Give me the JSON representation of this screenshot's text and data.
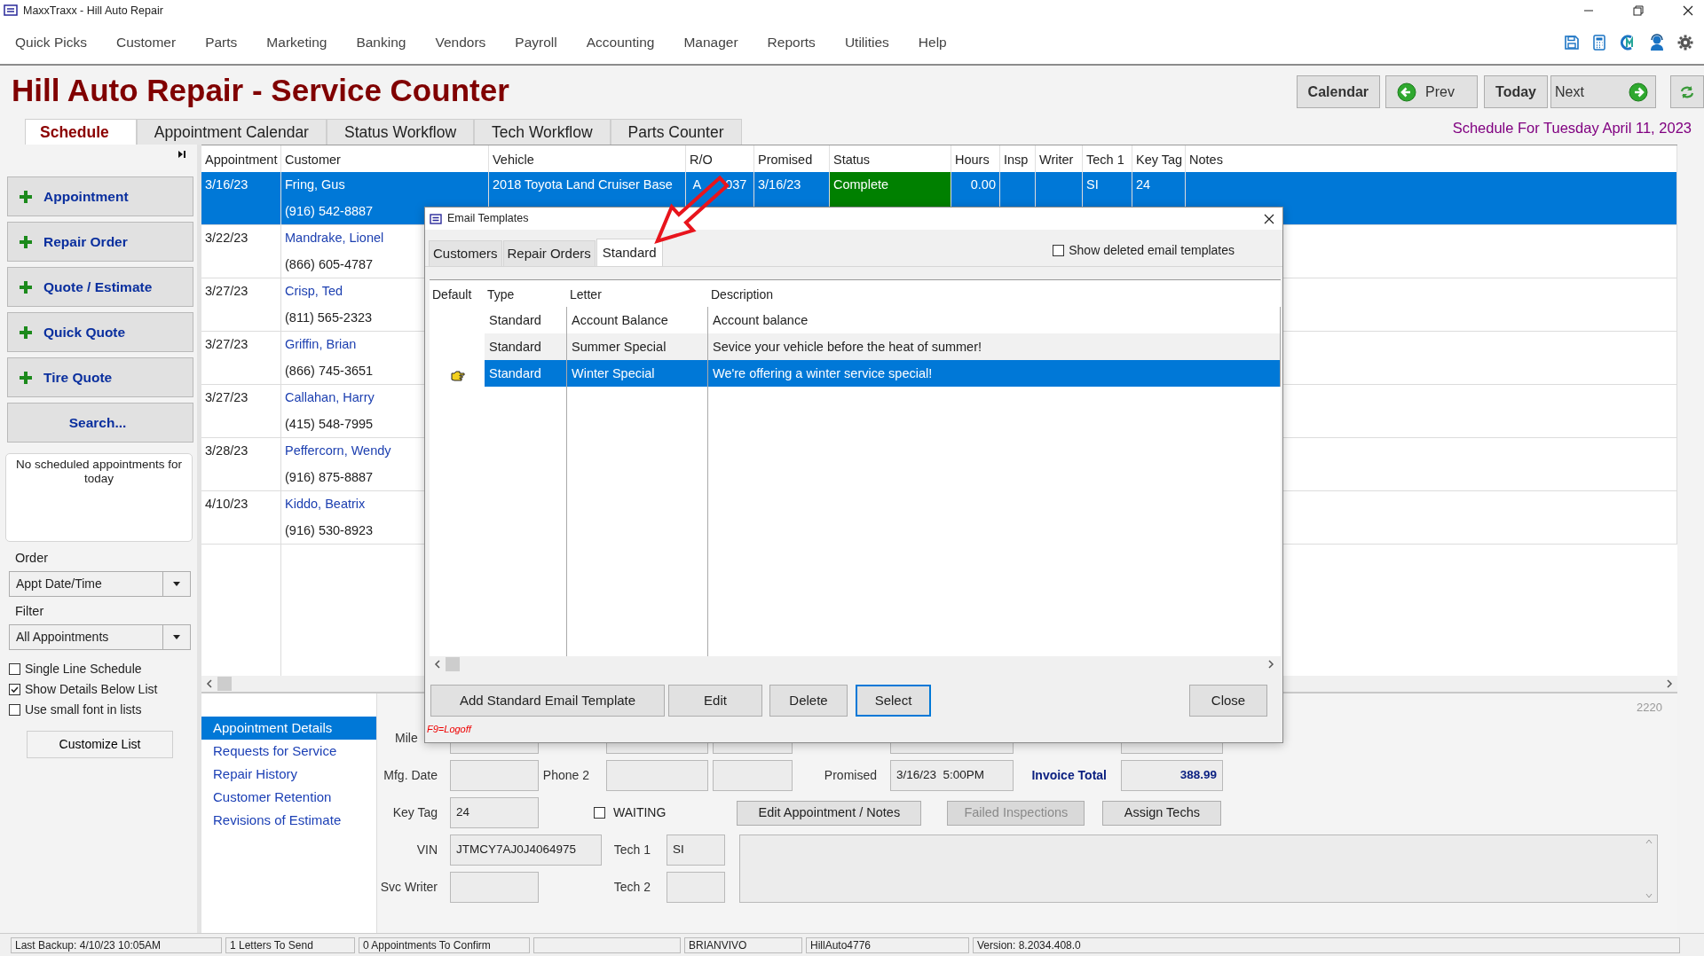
{
  "window": {
    "title": "MaxxTraxx - Hill Auto Repair"
  },
  "menu": [
    {
      "label": "Quick Picks"
    },
    {
      "label": "Customer"
    },
    {
      "label": "Parts"
    },
    {
      "label": "Marketing"
    },
    {
      "label": "Banking"
    },
    {
      "label": "Vendors"
    },
    {
      "label": "Payroll"
    },
    {
      "label": "Accounting"
    },
    {
      "label": "Manager"
    },
    {
      "label": "Reports"
    },
    {
      "label": "Utilities"
    },
    {
      "label": "Help"
    }
  ],
  "header": {
    "title": "Hill Auto Repair - Service Counter",
    "buttons": [
      {
        "kind": "bold",
        "label": "Calendar"
      },
      {
        "kind": "prev",
        "label": "Prev"
      },
      {
        "kind": "bold",
        "label": "Today"
      },
      {
        "kind": "next",
        "label": "Next"
      },
      {
        "kind": "refresh"
      }
    ]
  },
  "tabs": [
    {
      "label": "Schedule",
      "selected": true
    },
    {
      "label": "Appointment Calendar",
      "selected": false
    },
    {
      "label": "Status Workflow",
      "selected": false
    },
    {
      "label": "Tech Workflow",
      "selected": false
    },
    {
      "label": "Parts Counter",
      "selected": false
    }
  ],
  "schedule_caption": "Schedule For Tuesday April 11, 2023",
  "sidebar": {
    "actions": [
      {
        "kind": "add",
        "label": "Appointment"
      },
      {
        "kind": "add",
        "label": "Repair Order"
      },
      {
        "kind": "add",
        "label": "Quote / Estimate"
      },
      {
        "kind": "add",
        "label": "Quick Quote"
      },
      {
        "kind": "add",
        "label": "Tire Quote"
      },
      {
        "kind": "plain",
        "label": "Search..."
      }
    ],
    "notice": "No scheduled appointments for today",
    "order": {
      "label": "Order",
      "value": "Appt Date/Time"
    },
    "filter": {
      "label": "Filter",
      "value": "All Appointments"
    },
    "options": [
      {
        "label": "Single Line Schedule",
        "checked": false
      },
      {
        "label": "Show Details Below List",
        "checked": true
      },
      {
        "label": "Use small font in lists",
        "checked": false
      }
    ],
    "customize_button": "Customize List"
  },
  "schedule": {
    "columns": [
      "Appointment",
      "Customer",
      "Vehicle",
      "R/O",
      "Promised",
      "Status",
      "Hours",
      "Insp",
      "Writer",
      "Tech 1",
      "Key Tag",
      "Notes"
    ],
    "rows": [
      {
        "appointment": "3/16/23",
        "customer": "Fring, Gus",
        "phone": "(916) 542-8887",
        "vehicle": "2018 Toyota  Land Cruiser Base",
        "ro_visible": [
          "A",
          "037"
        ],
        "promised": "3/16/23",
        "status": {
          "text": "Complete",
          "color": "#008000"
        },
        "hours": "0.00",
        "tech_1": "SI",
        "key_tag": "24",
        "selected": true
      },
      {
        "appointment": "3/22/23",
        "customer": "Mandrake, Lionel",
        "phone": "(866) 605-4787",
        "selected": false
      },
      {
        "appointment": "3/27/23",
        "customer": "Crisp, Ted",
        "phone": "(811) 565-2323",
        "selected": false
      },
      {
        "appointment": "3/27/23",
        "customer": "Griffin, Brian",
        "phone": "(866) 745-3651",
        "selected": false
      },
      {
        "appointment": "3/27/23",
        "customer": "Callahan, Harry",
        "phone": "(415) 548-7995",
        "selected": false
      },
      {
        "appointment": "3/28/23",
        "customer": "Peffercorn, Wendy",
        "phone": "(916) 875-8887",
        "selected": false
      },
      {
        "appointment": "4/10/23",
        "customer": "Kiddo, Beatrix",
        "phone": "(916) 530-8923",
        "selected": false
      }
    ]
  },
  "details": {
    "nav": [
      {
        "label": "Appointment Details",
        "selected": true
      },
      {
        "label": "Requests for Service",
        "selected": false
      },
      {
        "label": "Repair History",
        "selected": false
      },
      {
        "label": "Customer Retention",
        "selected": false
      },
      {
        "label": "Revisions of Estimate",
        "selected": false
      }
    ],
    "counter": "2220",
    "form": {
      "mileage": {
        "label": "Mile"
      },
      "mfg_date": {
        "label": "Mfg. Date"
      },
      "phone_2": {
        "label": "Phone 2"
      },
      "promised": {
        "label": "Promised",
        "value": "3/16/23  5:00PM"
      },
      "invoice_total": {
        "label": "Invoice Total",
        "value": "388.99"
      },
      "key_tag": {
        "label": "Key Tag",
        "value": "24"
      },
      "waiting": {
        "label": "WAITING",
        "checked": false
      },
      "buttons": [
        {
          "label": "Edit Appointment / Notes",
          "disabled": false
        },
        {
          "label": "Failed Inspections",
          "disabled": true
        },
        {
          "label": "Assign Techs",
          "disabled": false
        }
      ],
      "vin": {
        "label": "VIN",
        "value": "JTMCY7AJ0J4064975"
      },
      "tech_1": {
        "label": "Tech 1",
        "value": "SI"
      },
      "svc_writer": {
        "label": "Svc Writer"
      },
      "tech_2": {
        "label": "Tech 2"
      }
    }
  },
  "email_dialog": {
    "title": "Email Templates",
    "tabs": [
      {
        "label": "Customers",
        "selected": false
      },
      {
        "label": "Repair Orders",
        "selected": false
      },
      {
        "label": "Standard",
        "selected": true
      }
    ],
    "show_deleted": {
      "label": "Show deleted email templates",
      "checked": false
    },
    "columns": [
      "Default",
      "Type",
      "Letter",
      "Description"
    ],
    "rows": [
      {
        "type": "Standard",
        "letter": "Account Balance",
        "description": "Account balance",
        "selected": false
      },
      {
        "type": "Standard",
        "letter": "Summer Special",
        "description": "Sevice your vehicle before the heat of summer!",
        "selected": false
      },
      {
        "type": "Standard",
        "letter": "Winter Special",
        "description": "We're offering a winter service special!",
        "selected": true
      }
    ],
    "buttons": [
      {
        "label": "Add Standard Email Template",
        "focused": false
      },
      {
        "label": "Edit",
        "focused": false
      },
      {
        "label": "Delete",
        "focused": false
      },
      {
        "label": "Select",
        "focused": true
      }
    ],
    "close_button": "Close",
    "hint": "F9=Logoff"
  },
  "status_bar": [
    {
      "kind": "text",
      "text": "Last Backup:  4/10/23  10:05AM"
    },
    {
      "kind": "text",
      "text": "1 Letters To Send"
    },
    {
      "kind": "text",
      "text": "0 Appointments To Confirm"
    },
    {
      "kind": "blank"
    },
    {
      "kind": "text",
      "text": "BRIANVIVO"
    },
    {
      "kind": "text",
      "text": "HillAuto4776"
    },
    {
      "kind": "text",
      "text": "Version:  8.2034.408.0"
    }
  ]
}
